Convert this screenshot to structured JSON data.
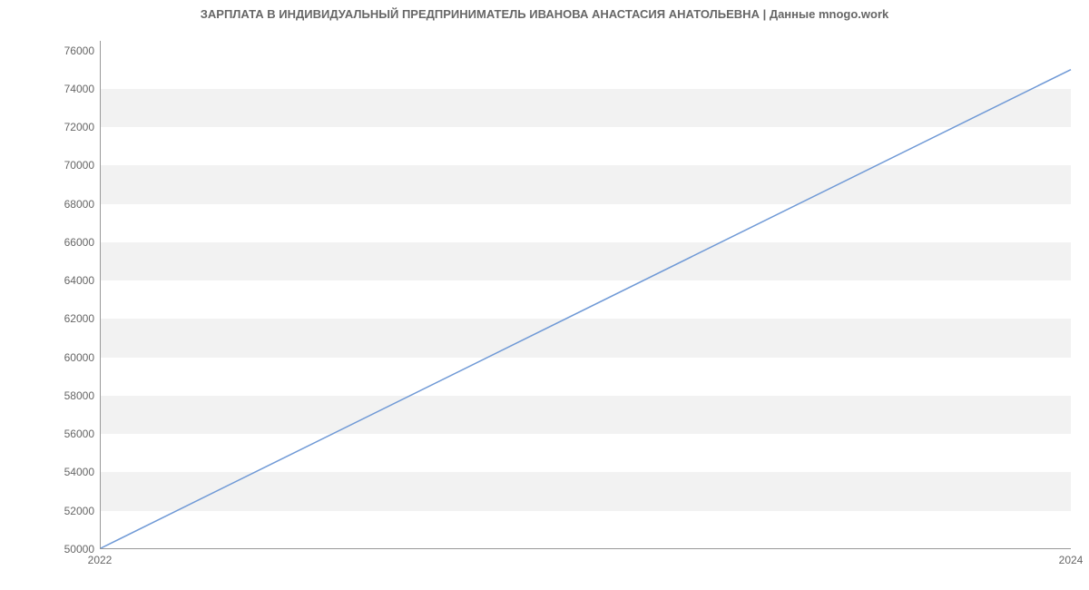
{
  "chart_data": {
    "type": "line",
    "title": "ЗАРПЛАТА В ИНДИВИДУАЛЬНЫЙ ПРЕДПРИНИМАТЕЛЬ ИВАНОВА АНАСТАСИЯ АНАТОЛЬЕВНА | Данные mnogo.work",
    "xlabel": "",
    "ylabel": "",
    "x": [
      2022,
      2024
    ],
    "values": [
      50000,
      75000
    ],
    "x_ticks": [
      2022,
      2024
    ],
    "y_ticks": [
      50000,
      52000,
      54000,
      56000,
      58000,
      60000,
      62000,
      64000,
      66000,
      68000,
      70000,
      72000,
      74000,
      76000
    ],
    "ylim": [
      50000,
      76500
    ],
    "xlim": [
      2022,
      2024
    ],
    "grid": true,
    "line_color": "#6f99d6",
    "band_color": "#f2f2f2"
  }
}
